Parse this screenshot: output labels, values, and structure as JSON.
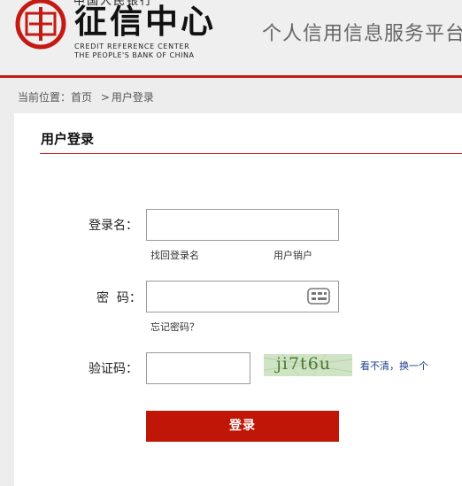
{
  "header": {
    "logo_top": "中国人民银行",
    "logo_cn": "征信中心",
    "logo_en_line1": "CREDIT REFERENCE CENTER",
    "logo_en_line2": "THE PEOPLE'S BANK OF CHINA",
    "slogan": "个人信用信息服务平台"
  },
  "breadcrumb": {
    "prefix": "当前位置：",
    "home": "首页",
    "separator": ">",
    "current": "用户登录"
  },
  "login": {
    "title": "用户登录",
    "username_label": "登录名：",
    "username_value": "",
    "find_username": "找回登录名",
    "cancel_account": "用户销户",
    "password_label": "密  码：",
    "password_value": "",
    "forgot_password": "忘记密码？",
    "captcha_label": "验证码：",
    "captcha_value": "",
    "captcha_text": "ji7t6u",
    "refresh_captcha": "看不清，换一个",
    "submit": "登录"
  },
  "colors": {
    "accent": "#c41a14",
    "button": "#c01608",
    "link": "#1d3f8c"
  }
}
